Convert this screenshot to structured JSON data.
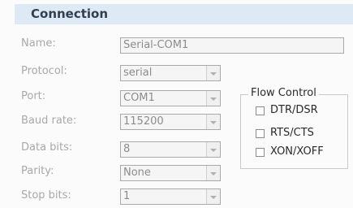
{
  "section": {
    "title": "Connection"
  },
  "fields": {
    "name": {
      "label": "Name:",
      "value": "Serial-COM1"
    },
    "protocol": {
      "label": "Protocol:",
      "value": "serial"
    },
    "port": {
      "label": "Port:",
      "value": "COM1"
    },
    "baud_rate": {
      "label": "Baud rate:",
      "value": "115200"
    },
    "data_bits": {
      "label": "Data bits:",
      "value": "8"
    },
    "parity": {
      "label": "Parity:",
      "value": "None"
    },
    "stop_bits": {
      "label": "Stop bits:",
      "value": "1"
    }
  },
  "flow_control": {
    "title": "Flow Control",
    "options": [
      {
        "label": "DTR/DSR",
        "checked": false
      },
      {
        "label": "RTS/CTS",
        "checked": false
      },
      {
        "label": "XON/XOFF",
        "checked": false
      }
    ]
  },
  "colors": {
    "header_bg": "#dde9f5",
    "header_text": "#303e4e",
    "disabled_text": "#a8a8a8"
  },
  "icons": {
    "dropdown": "chevron-down-icon"
  }
}
